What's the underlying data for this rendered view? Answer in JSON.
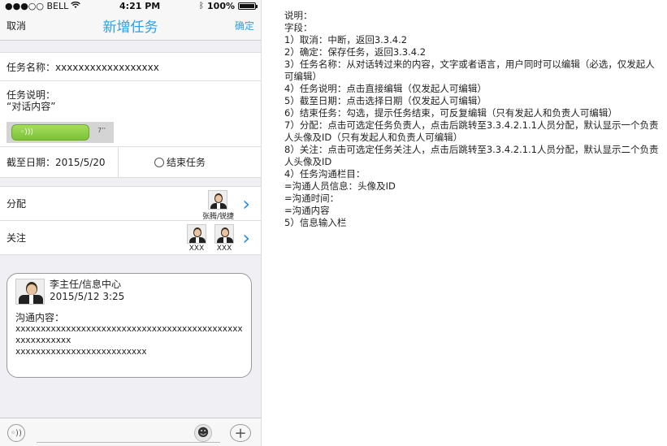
{
  "status_bar": {
    "carrier": "●●●○○ BELL",
    "time": "4:21 PM",
    "battery": "100%"
  },
  "nav": {
    "cancel": "取消",
    "title": "新增任务",
    "confirm": "确定"
  },
  "form": {
    "task_name": "任务名称：xxxxxxxxxxxxxxxxxx",
    "task_desc_label": "任务说明：",
    "task_desc_value": "“对话内容”",
    "voice_length": "7‘’",
    "deadline": "截至日期：2015/5/20",
    "end_task": "结束任务"
  },
  "assign": {
    "label": "分配",
    "people": [
      {
        "name": "张腾/锐捷"
      }
    ]
  },
  "follow": {
    "label": "关注",
    "people": [
      {
        "name": "XXX"
      },
      {
        "name": "XXX"
      }
    ]
  },
  "chat": {
    "sender": "李主任/信息中心",
    "time": "2015/5/12 3:25",
    "content_label": "沟通内容：",
    "content": "xxxxxxxxxxxxxxxxxxxxxxxxxxxxxxxxxxxxxxxxxxxxxxxxxxxxxxxx\nxxxxxxxxxxxxxxxxxxxxxxxxxx"
  },
  "notes": [
    "说明：",
    "字段：",
    "1）取消：中断，返回3.3.4.2",
    "2）确定：保存任务，返回3.3.4.2",
    "3）任务名称：从对话转过来的内容，文字或者语言，用户同时可以编辑（必选，仅发起人可编辑）",
    "4）任务说明：点击直接编辑（仅发起人可编辑）",
    "5）截至日期：点击选择日期（仅发起人可编辑）",
    "6）结束任务：勾选，提示任务结束，可反复编辑（只有发起人和负责人可编辑）",
    "7）分配：点击可选定任务负责人，点击后跳转至3.3.4.2.1.1人员分配，默认显示一个负责人头像及ID（只有发起人和负责人可编辑）",
    "8）关注：点击可选定任务关注人，点击后跳转至3.3.4.2.1.1人员分配，默认显示二个负责人头像及ID",
    "4）任务沟通栏目：",
    "=沟通人员信息：头像及ID",
    "=沟通时间：",
    "=沟通内容",
    "5）信息输入栏"
  ]
}
